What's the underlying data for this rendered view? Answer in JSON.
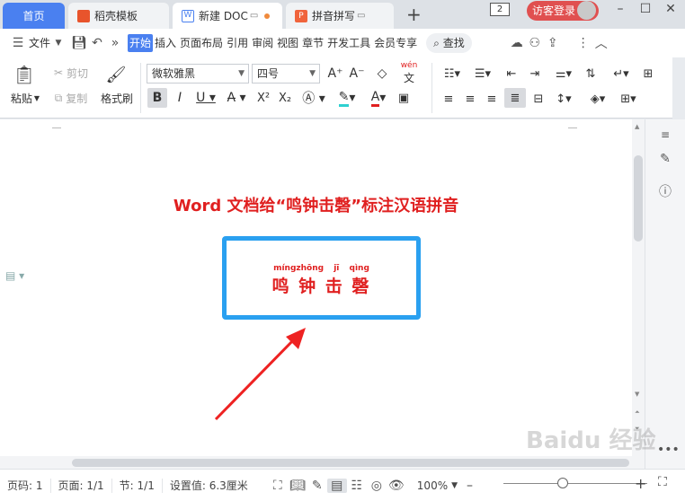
{
  "tabs": {
    "home": "首页",
    "doc1": "稻壳模板",
    "doc2": "新建 DOC",
    "doc3": "拼音拼写",
    "badge": "2",
    "login": "访客登录"
  },
  "menu": {
    "file": "文件",
    "items": [
      "开始",
      "插入",
      "页面布局",
      "引用",
      "审阅",
      "视图",
      "章节",
      "开发工具",
      "会员专享"
    ],
    "search": "查找"
  },
  "ribbon": {
    "paste": "粘贴",
    "cut": "剪切",
    "copy": "复制",
    "format_painter": "格式刷",
    "font_name": "微软雅黑",
    "font_size": "四号",
    "pinyin_label": "wén"
  },
  "document": {
    "title": "Word 文档给“鸣钟击磬”标注汉语拼音",
    "pinyin": "míngzhōng jī qìng",
    "hanzi": "鸣 钟 击 磬"
  },
  "status": {
    "page": "页码: 1",
    "pages": "页面: 1/1",
    "section": "节: 1/1",
    "setting": "设置值: 6.3厘米",
    "zoom": "100%"
  },
  "watermark": "Baidu 经验",
  "colors": {
    "accent": "#4a80f0",
    "title_red": "#e02020",
    "box_blue": "#2aa0f0",
    "login_red": "#e05050"
  }
}
